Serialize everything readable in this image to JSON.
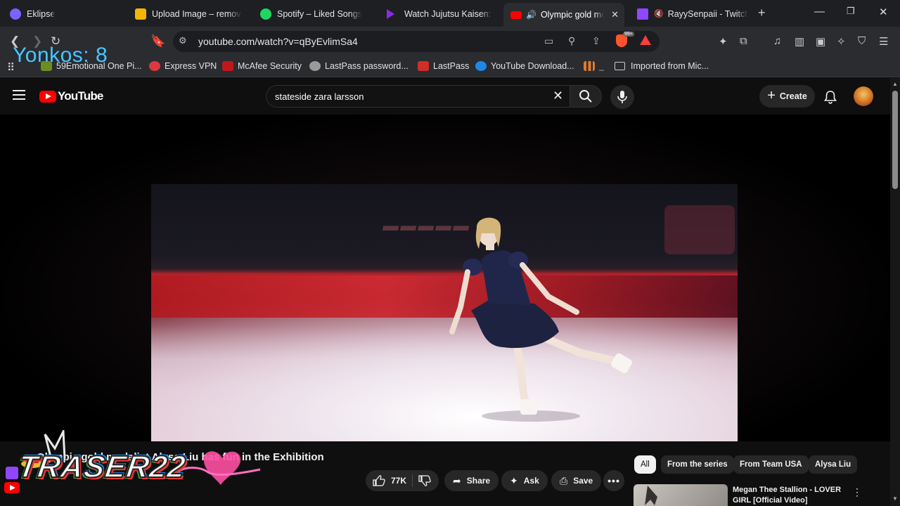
{
  "browser": {
    "tabs": [
      {
        "title": "Eklipse",
        "color": "#7b61ff"
      },
      {
        "title": "Upload Image – remove",
        "color": "#f2b705"
      },
      {
        "title": "Spotify – Liked Songs",
        "color": "#1ed760"
      },
      {
        "title": "Watch Jujutsu Kaisen: Th",
        "color": "#8a2be2"
      },
      {
        "title": "Olympic gold me",
        "color": "#ff0000"
      },
      {
        "title": "RayySenpaii - Twitch",
        "color": "#9146ff"
      }
    ],
    "url": "youtube.com/watch?v=qByEvlimSa4",
    "bookmarks": [
      {
        "label": "59Emotional One Pi...",
        "color": "#6b8e23"
      },
      {
        "label": "Express VPN",
        "color": "#da3940"
      },
      {
        "label": "McAfee Security",
        "color": "#c01818"
      },
      {
        "label": "LastPass password...",
        "color": "#9a9a9a"
      },
      {
        "label": "LastPass",
        "color": "#d32d27"
      },
      {
        "label": "YouTube Download...",
        "color": "#1e88e5"
      },
      {
        "label": "Imported from Mic...",
        "color": "#9a9a9a"
      }
    ],
    "brave_badge": "99+"
  },
  "overlay": {
    "counter_text": "Yonkos: 8",
    "streamer_name": "TRASER22"
  },
  "youtube": {
    "logo_text": "YouTube",
    "search_value": "stateside zara larsson",
    "create_label": "Create",
    "video_title": "Olympic gold medalist Alysa Liu has fun in the Exhibition",
    "actions": {
      "like_count": "77K",
      "share_label": "Share",
      "ask_label": "Ask",
      "save_label": "Save"
    },
    "chips": [
      "All",
      "From the series",
      "From Team USA",
      "Alysa Liu"
    ],
    "recommendation": {
      "title": "Megan Thee Stallion - LOVER GIRL [Official Video]"
    }
  }
}
